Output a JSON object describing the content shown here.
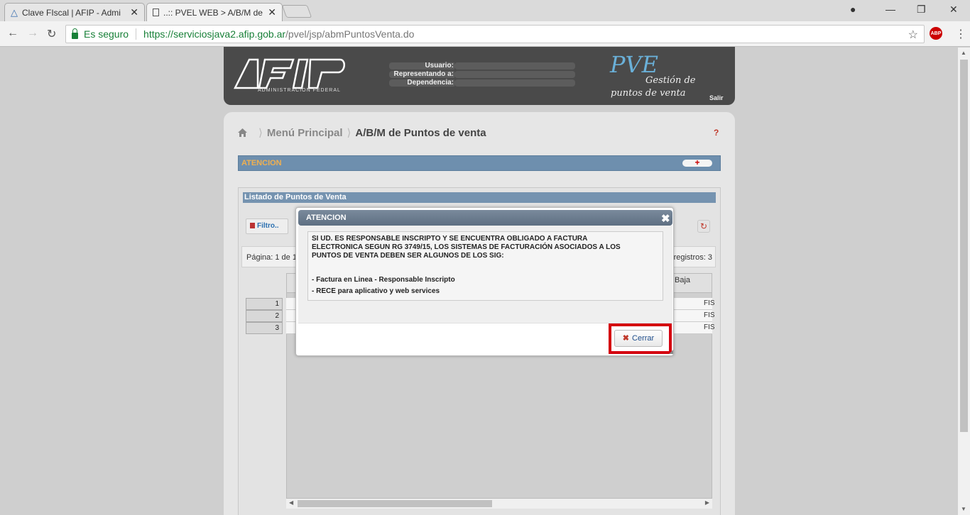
{
  "browser": {
    "tabs": [
      {
        "title": "Clave FIscal | AFIP - Admi"
      },
      {
        "title": "..:: PVEL WEB > A/B/M de"
      }
    ],
    "secure_label": "Es seguro",
    "url_host": "https://serviciosjava2.afip.gob.ar",
    "url_path": "/pvel/jsp/abmPuntosVenta.do",
    "abp_label": "ABP"
  },
  "header": {
    "logo_subtitle": "ADMINISTRACION FEDERAL",
    "fields": [
      {
        "label": "Usuario:"
      },
      {
        "label": "Representando a:"
      },
      {
        "label": "Dependencia:"
      }
    ],
    "app_name": "PVE",
    "app_subtitle_1": "Gestión de",
    "app_subtitle_2": "puntos de venta",
    "logout": "Salir"
  },
  "breadcrumb": {
    "items": [
      "Menú Principal",
      "A/B/M de Puntos de venta"
    ]
  },
  "help_label": "?",
  "atencion_section": {
    "title": "ATENCION",
    "expand_label": "+"
  },
  "grid": {
    "caption": "Listado de Puntos de Venta",
    "filter_label": "Filtro..",
    "pager_text": "Página: 1 de 1",
    "records_text": "registros: 3",
    "column_baja": "Baja",
    "row_numbers": [
      "1",
      "2",
      "3"
    ],
    "fis_values": [
      "FIS",
      "FIS",
      "FIS"
    ]
  },
  "modal": {
    "title": "ATENCION",
    "close_label": "✖",
    "message_lines": [
      "SI UD. ES RESPONSABLE INSCRIPTO Y SE ENCUENTRA OBLIGADO A FACTURA",
      "ELECTRONICA SEGUN RG 3749/15, LOS SISTEMAS DE FACTURACIÓN ASOCIADOS A LOS",
      "PUNTOS DE VENTA DEBEN SER ALGUNOS DE LOS SIG:"
    ],
    "list_items": [
      "- Factura en Linea - Responsable Inscripto",
      "- RECE para aplicativo y web services"
    ],
    "button_label": "Cerrar",
    "highlight_color": "#d4000f"
  }
}
